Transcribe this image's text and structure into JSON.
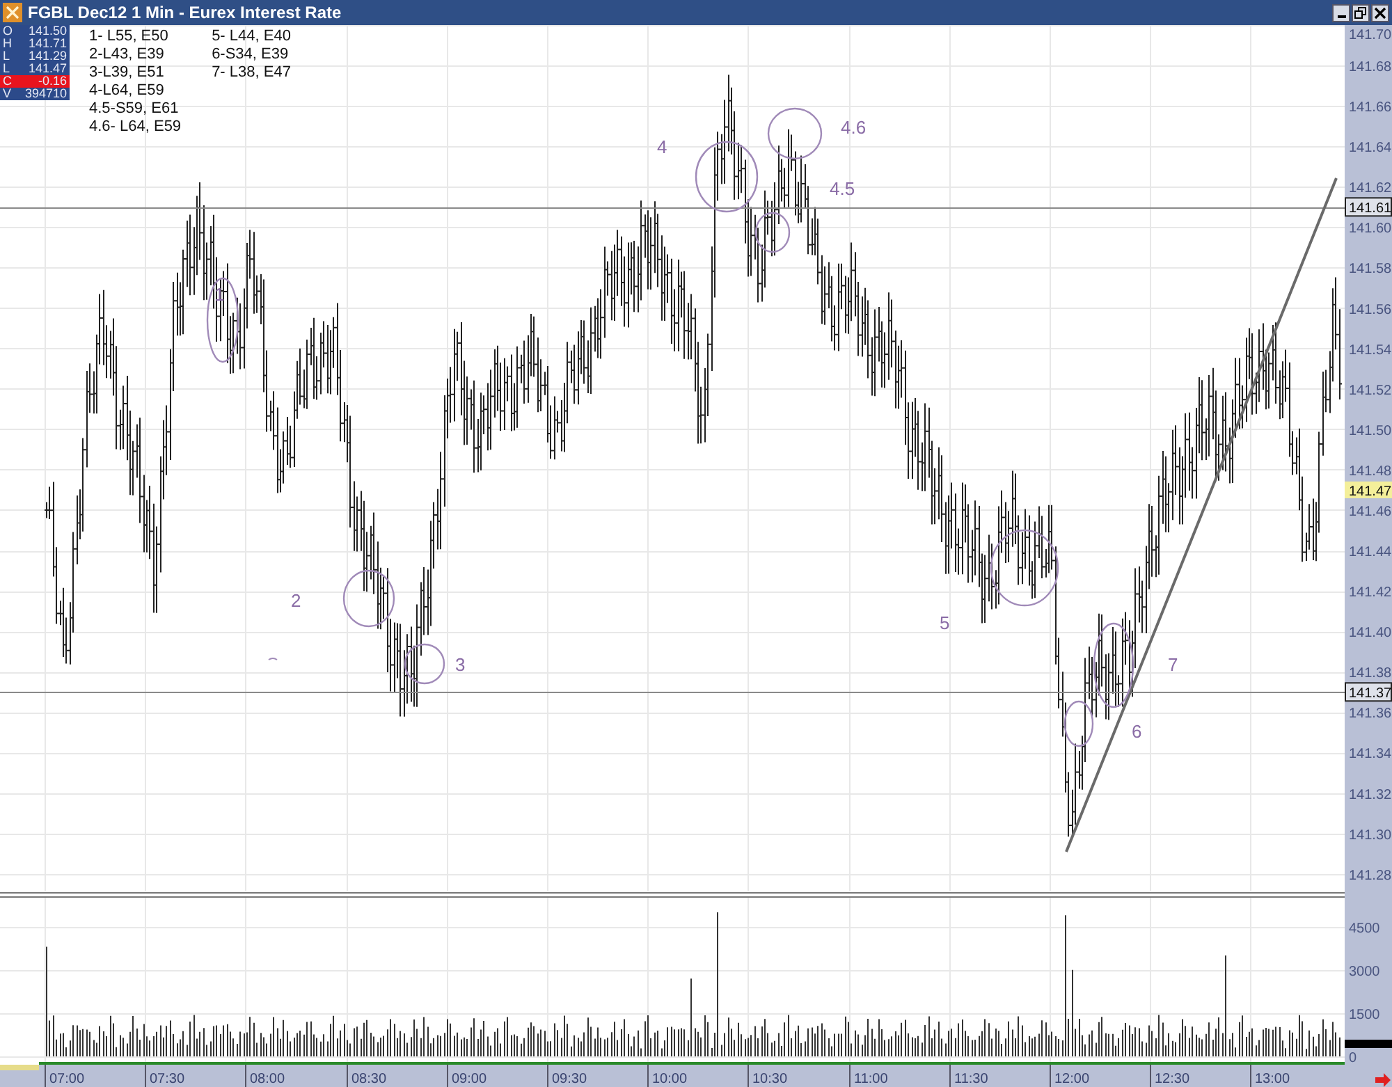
{
  "window": {
    "title": "FGBL Dec12 1 Min - Eurex Interest Rate"
  },
  "quote_box": [
    {
      "label": "O",
      "value": "141.50",
      "kind": "normal"
    },
    {
      "label": "H",
      "value": "141.71",
      "kind": "normal"
    },
    {
      "label": "L",
      "value": "141.29",
      "kind": "normal"
    },
    {
      "label": "L",
      "value": "141.47",
      "kind": "normal"
    },
    {
      "label": "C",
      "value": "-0.16",
      "kind": "change"
    },
    {
      "label": "V",
      "value": "394710",
      "kind": "normal"
    }
  ],
  "notes": {
    "column_1": [
      "1- L55, E50",
      "2-L43, E39",
      "3-L39, E51",
      "4-L64, E59",
      "4.5-S59, E61",
      "4.6- L64, E59"
    ],
    "column_2": [
      "5- L44, E40",
      "6-S34, E39",
      "7- L38, E47"
    ]
  },
  "annotations": [
    "1",
    "2",
    "3",
    "4",
    "4.5",
    "4.6",
    "5",
    "6",
    "7"
  ],
  "price_axis": {
    "ticks": [
      "141.70",
      "141.68",
      "141.66",
      "141.64",
      "141.62",
      "141.60",
      "141.58",
      "141.56",
      "141.54",
      "141.52",
      "141.50",
      "141.48",
      "141.46",
      "141.44",
      "141.42",
      "141.40",
      "141.38",
      "141.36",
      "141.34",
      "141.32",
      "141.30",
      "141.28"
    ],
    "markers": [
      {
        "value": "141.61",
        "kind": "line"
      },
      {
        "value": "141.47",
        "kind": "last"
      },
      {
        "value": "141.37",
        "kind": "line"
      }
    ]
  },
  "volume_axis": {
    "ticks": [
      "4500",
      "3000",
      "1500",
      "0"
    ]
  },
  "time_axis": {
    "ticks": [
      "07:00",
      "07:30",
      "08:00",
      "08:30",
      "09:00",
      "09:30",
      "10:00",
      "10:30",
      "11:00",
      "11:30",
      "12:00",
      "12:30",
      "13:00"
    ]
  }
}
